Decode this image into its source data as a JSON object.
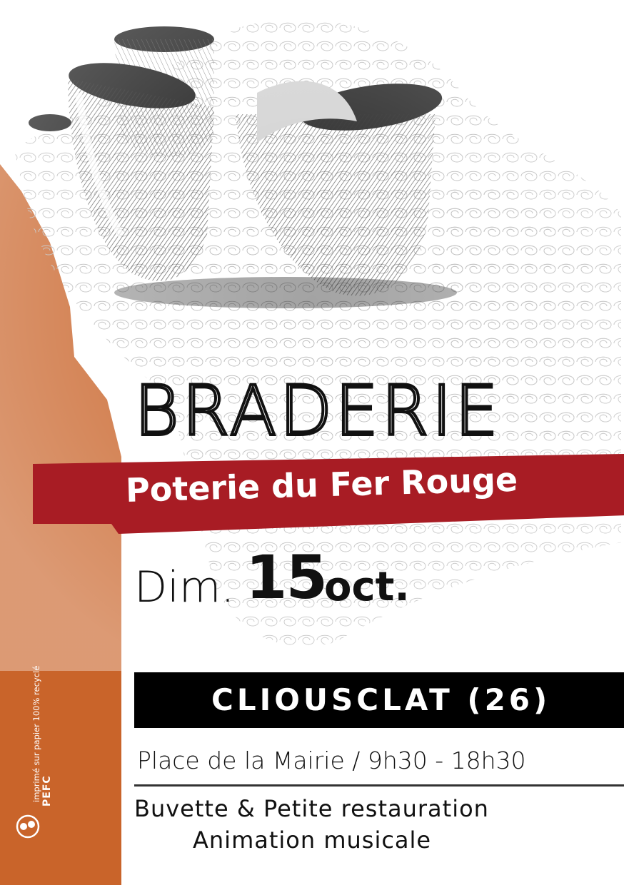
{
  "poster": {
    "title": "BRADERIE",
    "subtitle": "Poterie du Fer Rouge",
    "date": {
      "day": "Dim.",
      "number": "15",
      "month": "oct."
    },
    "city": "CLIOUSCLAT (26)",
    "address": "Place de la Mairie / 9h30 - 18h30",
    "extras": [
      "Buvette & Petite restauration",
      "Animation musicale"
    ]
  },
  "footer": {
    "printed_note": "imprimé sur papier 100% recyclé",
    "certification": "PEFC"
  },
  "colors": {
    "accent_orange": "#c9642a",
    "ribbon_red": "#a81c24",
    "bar_black": "#000000",
    "text_dark": "#111111"
  },
  "icons": [
    "pottery-cups-illustration",
    "pefc-logo-icon"
  ]
}
